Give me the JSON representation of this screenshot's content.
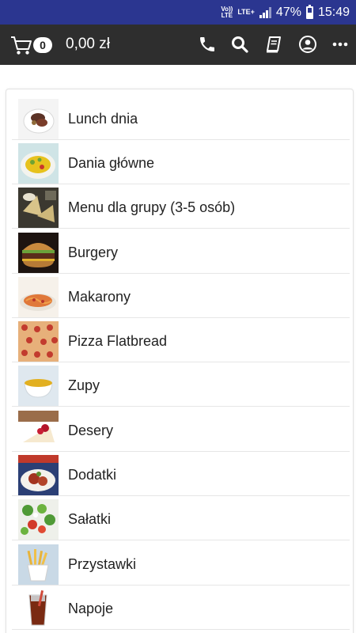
{
  "status_bar": {
    "volte_top": "Vo))",
    "volte_bottom": "LTE",
    "network": "LTE+",
    "battery": "47%",
    "time": "15:49"
  },
  "toolbar": {
    "cart_count": "0",
    "total": "0,00 zł",
    "icons": [
      "cart-icon",
      "phone-icon",
      "search-icon",
      "book-icon",
      "account-icon",
      "more-icon"
    ]
  },
  "categories": [
    {
      "label": "Lunch dnia"
    },
    {
      "label": "Dania główne"
    },
    {
      "label": "Menu dla grupy (3-5 osób)"
    },
    {
      "label": "Burgery"
    },
    {
      "label": "Makarony"
    },
    {
      "label": "Pizza Flatbread"
    },
    {
      "label": "Zupy"
    },
    {
      "label": "Desery"
    },
    {
      "label": "Dodatki"
    },
    {
      "label": "Sałatki"
    },
    {
      "label": "Przystawki"
    },
    {
      "label": "Napoje"
    }
  ],
  "colors": {
    "status_bar": "#2b3690",
    "toolbar": "#2e2e2e",
    "text": "#222222"
  }
}
